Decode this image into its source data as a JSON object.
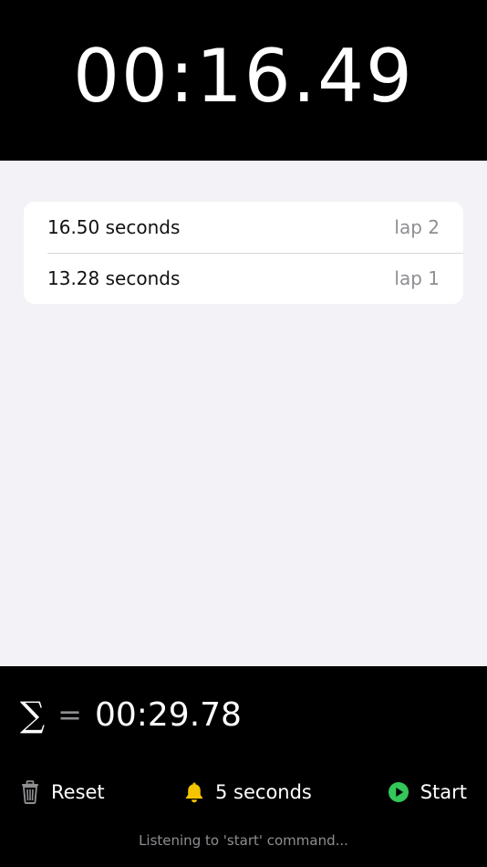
{
  "timer": {
    "display": "00:16.49"
  },
  "laps": [
    {
      "time": "16.50 seconds",
      "label": "lap 2"
    },
    {
      "time": "13.28 seconds",
      "label": "lap 1"
    }
  ],
  "total": {
    "symbol": "∑",
    "equals": "=",
    "value": "00:29.78"
  },
  "controls": {
    "reset_label": "Reset",
    "reset_icon": "trash-icon",
    "interval_label": "5 seconds",
    "interval_icon": "bell-icon",
    "start_label": "Start",
    "start_icon": "play-circle-icon"
  },
  "status": {
    "text": "Listening to 'start' command..."
  },
  "colors": {
    "background": "#f2f2f7",
    "header": "#000000",
    "bell": "#f5c400",
    "start": "#34c759",
    "secondary_text": "#8e8e93"
  }
}
